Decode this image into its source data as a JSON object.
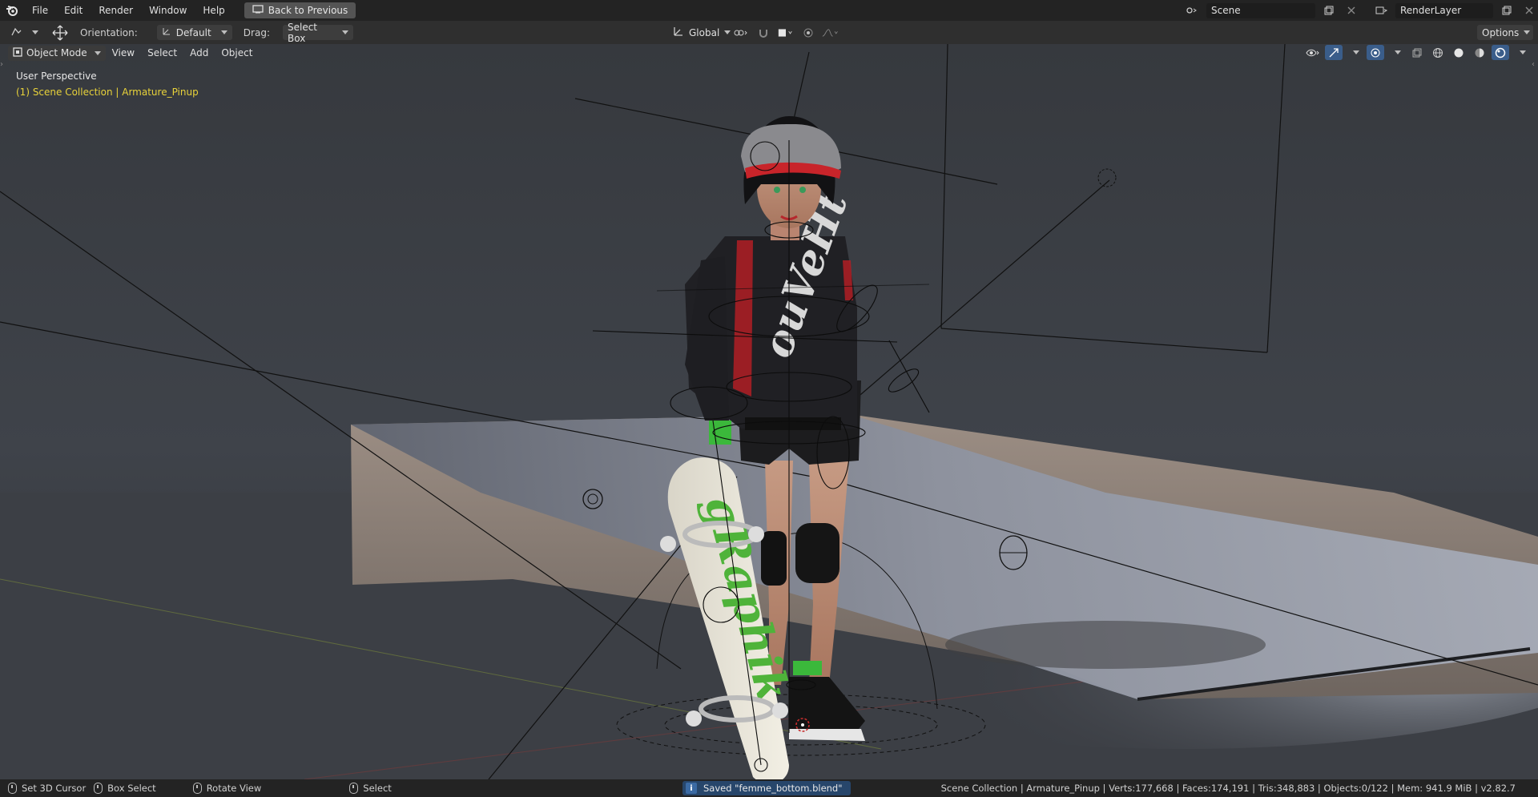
{
  "menu": {
    "items": [
      "File",
      "Edit",
      "Render",
      "Window",
      "Help"
    ],
    "back_label": "Back to Previous"
  },
  "scene": {
    "name": "Scene",
    "render_layer": "RenderLayer"
  },
  "toolheader": {
    "orientation_label": "Orientation:",
    "orientation_value": "Default",
    "drag_label": "Drag:",
    "drag_value": "Select Box",
    "transform_space": "Global",
    "options_label": "Options"
  },
  "viewheader": {
    "mode": "Object Mode",
    "items": [
      "View",
      "Select",
      "Add",
      "Object"
    ]
  },
  "viewport": {
    "perspective": "User Perspective",
    "collection": "(1) Scene Collection | Armature_Pinup",
    "accent_color": "#e8d23a"
  },
  "statusbar": {
    "left_items": [
      "Set 3D Cursor",
      "Box Select",
      "Rotate View",
      "Select"
    ],
    "saved_message": "Saved \"femme_bottom.blend\"",
    "stats": "Scene Collection | Armature_Pinup | Verts:177,668 | Faces:174,191 | Tris:348,883 | Objects:0/122 | Mem: 941.9 MiB | v2.82.7"
  },
  "model_graphics": {
    "shirt_print": "ouVeHt",
    "board_print": "gRaphik"
  }
}
